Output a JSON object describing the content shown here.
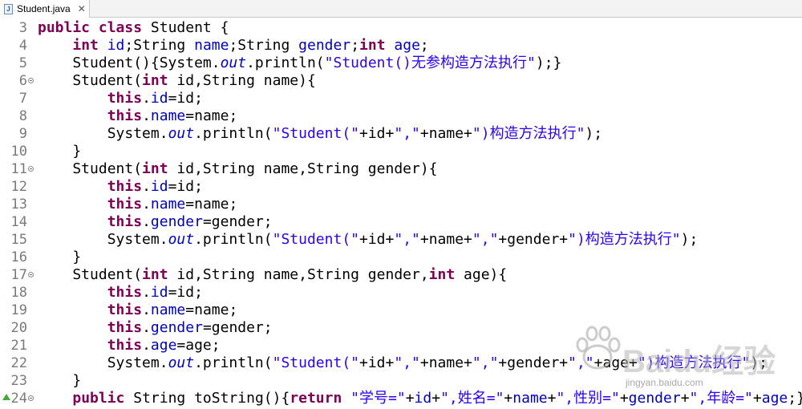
{
  "tab": {
    "title": "Student.java",
    "close": "✕",
    "icon": "java-file-icon"
  },
  "colors": {
    "keyword": "#7f0055",
    "field": "#0000c0",
    "string": "#2a00ff",
    "line_number": "#7a7a7a"
  },
  "lines": [
    {
      "num": "3",
      "fold": false,
      "marker": false,
      "tokens": [
        {
          "t": "public",
          "c": "kw"
        },
        {
          "t": " "
        },
        {
          "t": "class",
          "c": "kw"
        },
        {
          "t": " Student {"
        }
      ]
    },
    {
      "num": "4",
      "fold": false,
      "marker": false,
      "tokens": [
        {
          "t": "    "
        },
        {
          "t": "int",
          "c": "kw"
        },
        {
          "t": " "
        },
        {
          "t": "id",
          "c": "fld"
        },
        {
          "t": ";String "
        },
        {
          "t": "name",
          "c": "fld"
        },
        {
          "t": ";String "
        },
        {
          "t": "gender",
          "c": "fld"
        },
        {
          "t": ";"
        },
        {
          "t": "int",
          "c": "kw"
        },
        {
          "t": " "
        },
        {
          "t": "age",
          "c": "fld"
        },
        {
          "t": ";"
        }
      ]
    },
    {
      "num": "5",
      "fold": false,
      "marker": false,
      "tokens": [
        {
          "t": "    Student(){System."
        },
        {
          "t": "out",
          "c": "st"
        },
        {
          "t": ".println("
        },
        {
          "t": "\"Student()无参构造方法执行\"",
          "c": "str"
        },
        {
          "t": ");}"
        }
      ]
    },
    {
      "num": "6",
      "fold": true,
      "marker": false,
      "tokens": [
        {
          "t": "    Student("
        },
        {
          "t": "int",
          "c": "kw"
        },
        {
          "t": " id,String name){"
        }
      ]
    },
    {
      "num": "7",
      "fold": false,
      "marker": false,
      "tokens": [
        {
          "t": "        "
        },
        {
          "t": "this",
          "c": "kw"
        },
        {
          "t": "."
        },
        {
          "t": "id",
          "c": "fld"
        },
        {
          "t": "=id;"
        }
      ]
    },
    {
      "num": "8",
      "fold": false,
      "marker": false,
      "tokens": [
        {
          "t": "        "
        },
        {
          "t": "this",
          "c": "kw"
        },
        {
          "t": "."
        },
        {
          "t": "name",
          "c": "fld"
        },
        {
          "t": "=name;"
        }
      ]
    },
    {
      "num": "9",
      "fold": false,
      "marker": false,
      "tokens": [
        {
          "t": "        System."
        },
        {
          "t": "out",
          "c": "st"
        },
        {
          "t": ".println("
        },
        {
          "t": "\"Student(\"",
          "c": "str"
        },
        {
          "t": "+id+"
        },
        {
          "t": "\",\"",
          "c": "str"
        },
        {
          "t": "+name+"
        },
        {
          "t": "\")构造方法执行\"",
          "c": "str"
        },
        {
          "t": ");"
        }
      ]
    },
    {
      "num": "10",
      "fold": false,
      "marker": false,
      "tokens": [
        {
          "t": "    }"
        }
      ]
    },
    {
      "num": "11",
      "fold": true,
      "marker": false,
      "tokens": [
        {
          "t": "    Student("
        },
        {
          "t": "int",
          "c": "kw"
        },
        {
          "t": " id,String name,String gender){"
        }
      ]
    },
    {
      "num": "12",
      "fold": false,
      "marker": false,
      "tokens": [
        {
          "t": "        "
        },
        {
          "t": "this",
          "c": "kw"
        },
        {
          "t": "."
        },
        {
          "t": "id",
          "c": "fld"
        },
        {
          "t": "=id;"
        }
      ]
    },
    {
      "num": "13",
      "fold": false,
      "marker": false,
      "tokens": [
        {
          "t": "        "
        },
        {
          "t": "this",
          "c": "kw"
        },
        {
          "t": "."
        },
        {
          "t": "name",
          "c": "fld"
        },
        {
          "t": "=name;"
        }
      ]
    },
    {
      "num": "14",
      "fold": false,
      "marker": false,
      "tokens": [
        {
          "t": "        "
        },
        {
          "t": "this",
          "c": "kw"
        },
        {
          "t": "."
        },
        {
          "t": "gender",
          "c": "fld"
        },
        {
          "t": "=gender;"
        }
      ]
    },
    {
      "num": "15",
      "fold": false,
      "marker": false,
      "tokens": [
        {
          "t": "        System."
        },
        {
          "t": "out",
          "c": "st"
        },
        {
          "t": ".println("
        },
        {
          "t": "\"Student(\"",
          "c": "str"
        },
        {
          "t": "+id+"
        },
        {
          "t": "\",\"",
          "c": "str"
        },
        {
          "t": "+name+"
        },
        {
          "t": "\",\"",
          "c": "str"
        },
        {
          "t": "+gender+"
        },
        {
          "t": "\")构造方法执行\"",
          "c": "str"
        },
        {
          "t": ");"
        }
      ]
    },
    {
      "num": "16",
      "fold": false,
      "marker": false,
      "tokens": [
        {
          "t": "    }"
        }
      ]
    },
    {
      "num": "17",
      "fold": true,
      "marker": false,
      "tokens": [
        {
          "t": "    Student("
        },
        {
          "t": "int",
          "c": "kw"
        },
        {
          "t": " id,String name,String gender,"
        },
        {
          "t": "int",
          "c": "kw"
        },
        {
          "t": " age){"
        }
      ]
    },
    {
      "num": "18",
      "fold": false,
      "marker": false,
      "tokens": [
        {
          "t": "        "
        },
        {
          "t": "this",
          "c": "kw"
        },
        {
          "t": "."
        },
        {
          "t": "id",
          "c": "fld"
        },
        {
          "t": "=id;"
        }
      ]
    },
    {
      "num": "19",
      "fold": false,
      "marker": false,
      "tokens": [
        {
          "t": "        "
        },
        {
          "t": "this",
          "c": "kw"
        },
        {
          "t": "."
        },
        {
          "t": "name",
          "c": "fld"
        },
        {
          "t": "=name;"
        }
      ]
    },
    {
      "num": "20",
      "fold": false,
      "marker": false,
      "tokens": [
        {
          "t": "        "
        },
        {
          "t": "this",
          "c": "kw"
        },
        {
          "t": "."
        },
        {
          "t": "gender",
          "c": "fld"
        },
        {
          "t": "=gender;"
        }
      ]
    },
    {
      "num": "21",
      "fold": false,
      "marker": false,
      "tokens": [
        {
          "t": "        "
        },
        {
          "t": "this",
          "c": "kw"
        },
        {
          "t": "."
        },
        {
          "t": "age",
          "c": "fld"
        },
        {
          "t": "=age;"
        }
      ]
    },
    {
      "num": "22",
      "fold": false,
      "marker": false,
      "tokens": [
        {
          "t": "        System."
        },
        {
          "t": "out",
          "c": "st"
        },
        {
          "t": ".println("
        },
        {
          "t": "\"Student(\"",
          "c": "str"
        },
        {
          "t": "+id+"
        },
        {
          "t": "\",\"",
          "c": "str"
        },
        {
          "t": "+name+"
        },
        {
          "t": "\",\"",
          "c": "str"
        },
        {
          "t": "+gender+"
        },
        {
          "t": "\",\"",
          "c": "str"
        },
        {
          "t": "+age+"
        },
        {
          "t": "\")构造方法执行\"",
          "c": "str"
        },
        {
          "t": ");"
        }
      ]
    },
    {
      "num": "23",
      "fold": false,
      "marker": false,
      "tokens": [
        {
          "t": "    }"
        }
      ]
    },
    {
      "num": "24",
      "fold": true,
      "marker": true,
      "tokens": [
        {
          "t": "    "
        },
        {
          "t": "public",
          "c": "kw"
        },
        {
          "t": " String toString(){"
        },
        {
          "t": "return",
          "c": "kw"
        },
        {
          "t": " "
        },
        {
          "t": "\"学号=\"",
          "c": "str"
        },
        {
          "t": "+"
        },
        {
          "t": "id",
          "c": "fld"
        },
        {
          "t": "+"
        },
        {
          "t": "\",姓名=\"",
          "c": "str"
        },
        {
          "t": "+"
        },
        {
          "t": "name",
          "c": "fld"
        },
        {
          "t": "+"
        },
        {
          "t": "\",性别=\"",
          "c": "str"
        },
        {
          "t": "+"
        },
        {
          "t": "gender",
          "c": "fld"
        },
        {
          "t": "+"
        },
        {
          "t": "\",年龄=\"",
          "c": "str"
        },
        {
          "t": "+"
        },
        {
          "t": "age",
          "c": "fld"
        },
        {
          "t": ";}"
        }
      ]
    }
  ],
  "watermark": {
    "brand": "Baidu经验",
    "url": "jingyan.baidu.com",
    "icon": "baidu-paw-icon"
  }
}
